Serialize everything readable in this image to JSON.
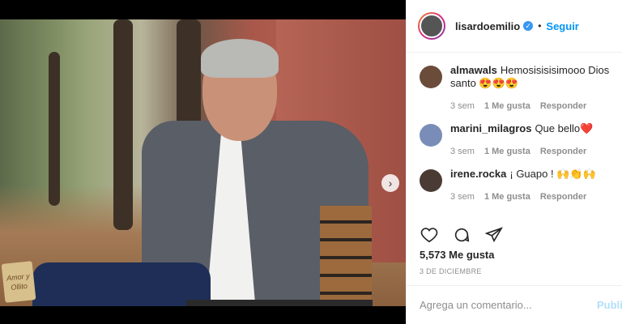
{
  "post": {
    "username": "lisardoemilio",
    "verified_mark": "✓",
    "separator": "•",
    "follow_label": "Seguir",
    "watermark_text": "Amor y Ollito",
    "carousel_next": "›",
    "carousel": {
      "total": 3,
      "active_index": 1
    }
  },
  "comments": [
    {
      "user": "almawals",
      "text": "Hemosisisisimooo Dios santo 😍😍😍",
      "time": "3 sem",
      "likes": "1 Me gusta",
      "reply": "Responder",
      "avatar_color": "#6b4b3a"
    },
    {
      "user": "marini_milagros",
      "text": "Que bello❤️",
      "time": "3 sem",
      "likes": "1 Me gusta",
      "reply": "Responder",
      "avatar_color": "#7a8db8"
    },
    {
      "user": "irene.rocka",
      "text": "¡ Guapo ! 🙌👏🙌",
      "time": "3 sem",
      "likes": "1 Me gusta",
      "reply": "Responder",
      "avatar_color": "#4a3b35"
    }
  ],
  "engagement": {
    "likes": "5,573 Me gusta",
    "date": "3 DE DICIEMBRE"
  },
  "composer": {
    "placeholder": "Agrega un comentario...",
    "publish": "Publi"
  },
  "icons": {
    "like": "heart-icon",
    "comment": "comment-bubble-icon",
    "share": "paper-plane-icon",
    "next": "chevron-right-icon"
  },
  "colors": {
    "accent": "#0095f6",
    "text": "#262626",
    "muted": "#8e8e8e"
  }
}
